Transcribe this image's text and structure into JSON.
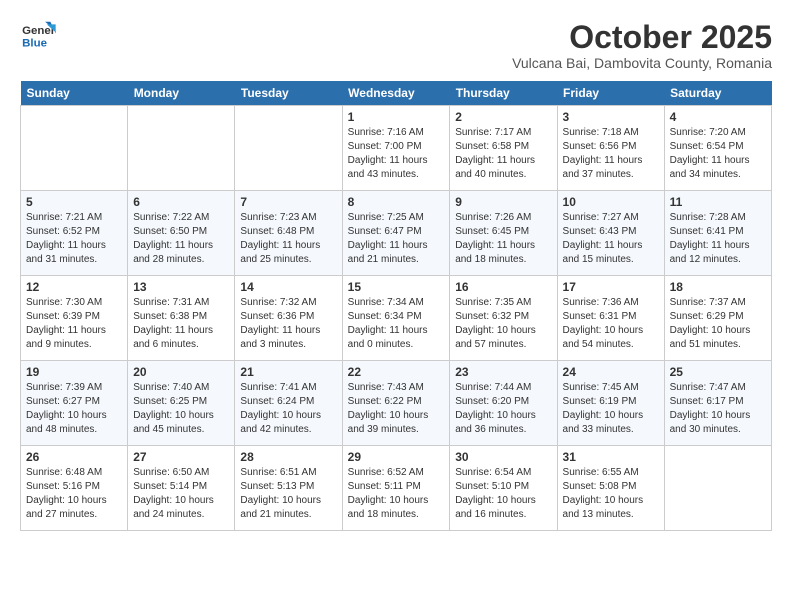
{
  "header": {
    "logo_line1": "General",
    "logo_line2": "Blue",
    "month": "October 2025",
    "location": "Vulcana Bai, Dambovita County, Romania"
  },
  "weekdays": [
    "Sunday",
    "Monday",
    "Tuesday",
    "Wednesday",
    "Thursday",
    "Friday",
    "Saturday"
  ],
  "weeks": [
    [
      {
        "day": "",
        "info": ""
      },
      {
        "day": "",
        "info": ""
      },
      {
        "day": "",
        "info": ""
      },
      {
        "day": "1",
        "info": "Sunrise: 7:16 AM\nSunset: 7:00 PM\nDaylight: 11 hours\nand 43 minutes."
      },
      {
        "day": "2",
        "info": "Sunrise: 7:17 AM\nSunset: 6:58 PM\nDaylight: 11 hours\nand 40 minutes."
      },
      {
        "day": "3",
        "info": "Sunrise: 7:18 AM\nSunset: 6:56 PM\nDaylight: 11 hours\nand 37 minutes."
      },
      {
        "day": "4",
        "info": "Sunrise: 7:20 AM\nSunset: 6:54 PM\nDaylight: 11 hours\nand 34 minutes."
      }
    ],
    [
      {
        "day": "5",
        "info": "Sunrise: 7:21 AM\nSunset: 6:52 PM\nDaylight: 11 hours\nand 31 minutes."
      },
      {
        "day": "6",
        "info": "Sunrise: 7:22 AM\nSunset: 6:50 PM\nDaylight: 11 hours\nand 28 minutes."
      },
      {
        "day": "7",
        "info": "Sunrise: 7:23 AM\nSunset: 6:48 PM\nDaylight: 11 hours\nand 25 minutes."
      },
      {
        "day": "8",
        "info": "Sunrise: 7:25 AM\nSunset: 6:47 PM\nDaylight: 11 hours\nand 21 minutes."
      },
      {
        "day": "9",
        "info": "Sunrise: 7:26 AM\nSunset: 6:45 PM\nDaylight: 11 hours\nand 18 minutes."
      },
      {
        "day": "10",
        "info": "Sunrise: 7:27 AM\nSunset: 6:43 PM\nDaylight: 11 hours\nand 15 minutes."
      },
      {
        "day": "11",
        "info": "Sunrise: 7:28 AM\nSunset: 6:41 PM\nDaylight: 11 hours\nand 12 minutes."
      }
    ],
    [
      {
        "day": "12",
        "info": "Sunrise: 7:30 AM\nSunset: 6:39 PM\nDaylight: 11 hours\nand 9 minutes."
      },
      {
        "day": "13",
        "info": "Sunrise: 7:31 AM\nSunset: 6:38 PM\nDaylight: 11 hours\nand 6 minutes."
      },
      {
        "day": "14",
        "info": "Sunrise: 7:32 AM\nSunset: 6:36 PM\nDaylight: 11 hours\nand 3 minutes."
      },
      {
        "day": "15",
        "info": "Sunrise: 7:34 AM\nSunset: 6:34 PM\nDaylight: 11 hours\nand 0 minutes."
      },
      {
        "day": "16",
        "info": "Sunrise: 7:35 AM\nSunset: 6:32 PM\nDaylight: 10 hours\nand 57 minutes."
      },
      {
        "day": "17",
        "info": "Sunrise: 7:36 AM\nSunset: 6:31 PM\nDaylight: 10 hours\nand 54 minutes."
      },
      {
        "day": "18",
        "info": "Sunrise: 7:37 AM\nSunset: 6:29 PM\nDaylight: 10 hours\nand 51 minutes."
      }
    ],
    [
      {
        "day": "19",
        "info": "Sunrise: 7:39 AM\nSunset: 6:27 PM\nDaylight: 10 hours\nand 48 minutes."
      },
      {
        "day": "20",
        "info": "Sunrise: 7:40 AM\nSunset: 6:25 PM\nDaylight: 10 hours\nand 45 minutes."
      },
      {
        "day": "21",
        "info": "Sunrise: 7:41 AM\nSunset: 6:24 PM\nDaylight: 10 hours\nand 42 minutes."
      },
      {
        "day": "22",
        "info": "Sunrise: 7:43 AM\nSunset: 6:22 PM\nDaylight: 10 hours\nand 39 minutes."
      },
      {
        "day": "23",
        "info": "Sunrise: 7:44 AM\nSunset: 6:20 PM\nDaylight: 10 hours\nand 36 minutes."
      },
      {
        "day": "24",
        "info": "Sunrise: 7:45 AM\nSunset: 6:19 PM\nDaylight: 10 hours\nand 33 minutes."
      },
      {
        "day": "25",
        "info": "Sunrise: 7:47 AM\nSunset: 6:17 PM\nDaylight: 10 hours\nand 30 minutes."
      }
    ],
    [
      {
        "day": "26",
        "info": "Sunrise: 6:48 AM\nSunset: 5:16 PM\nDaylight: 10 hours\nand 27 minutes."
      },
      {
        "day": "27",
        "info": "Sunrise: 6:50 AM\nSunset: 5:14 PM\nDaylight: 10 hours\nand 24 minutes."
      },
      {
        "day": "28",
        "info": "Sunrise: 6:51 AM\nSunset: 5:13 PM\nDaylight: 10 hours\nand 21 minutes."
      },
      {
        "day": "29",
        "info": "Sunrise: 6:52 AM\nSunset: 5:11 PM\nDaylight: 10 hours\nand 18 minutes."
      },
      {
        "day": "30",
        "info": "Sunrise: 6:54 AM\nSunset: 5:10 PM\nDaylight: 10 hours\nand 16 minutes."
      },
      {
        "day": "31",
        "info": "Sunrise: 6:55 AM\nSunset: 5:08 PM\nDaylight: 10 hours\nand 13 minutes."
      },
      {
        "day": "",
        "info": ""
      }
    ]
  ]
}
